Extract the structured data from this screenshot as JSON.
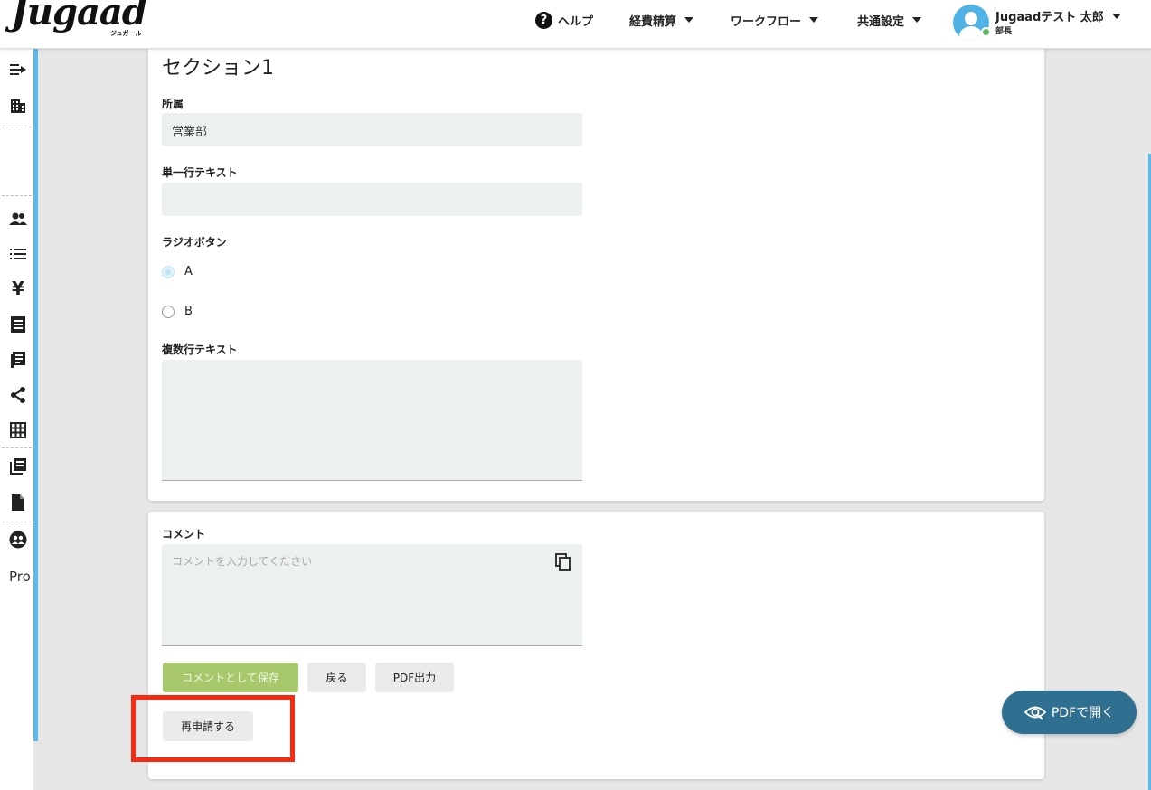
{
  "header": {
    "logo": "Jugaad",
    "logo_sub": "ジュガール",
    "nav": {
      "help": "ヘルプ",
      "expense": "経費精算",
      "workflow": "ワークフロー",
      "settings": "共通設定"
    },
    "user": {
      "name": "Jugaadテスト 太郎",
      "role": "部長"
    }
  },
  "sidebar": {
    "text_item": "Pro"
  },
  "form": {
    "section_title": "セクション1",
    "affiliation_label": "所属",
    "affiliation_value": "営業部",
    "single_text_label": "単一行テキスト",
    "single_text_value": "",
    "radio_label": "ラジオボタン",
    "radio_options": [
      "A",
      "B"
    ],
    "radio_selected": "A",
    "multi_text_label": "複数行テキスト",
    "multi_text_value": ""
  },
  "comment": {
    "label": "コメント",
    "placeholder": "コメントを入力してください",
    "save_button": "コメントとして保存",
    "back_button": "戻る",
    "pdf_button": "PDF出力",
    "reapply_button": "再申請する"
  },
  "floating": {
    "pdf_open": "PDFで開く"
  },
  "colors": {
    "accent": "#5bb8e8",
    "save_button": "#a7c96c",
    "highlight": "#f42a12",
    "pdf_open": "#2f6f8f"
  }
}
